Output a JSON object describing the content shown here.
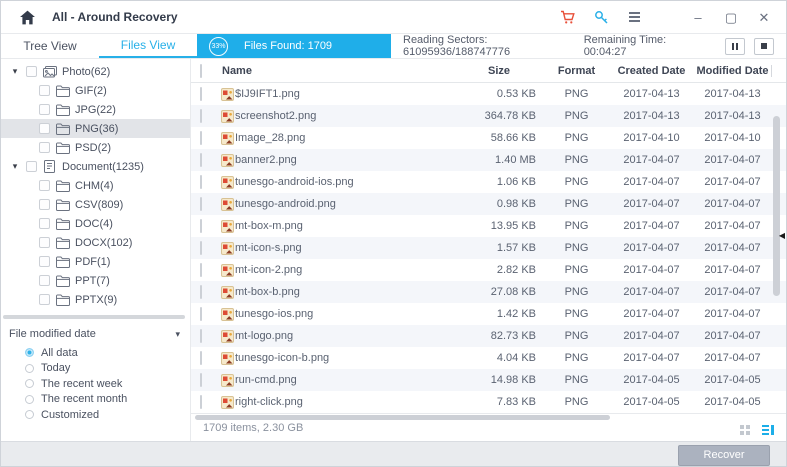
{
  "window": {
    "title": "All - Around Recovery"
  },
  "titlebar": {
    "icons": [
      "home-icon",
      "cart-icon",
      "key-icon",
      "menu-icon",
      "minimize-icon",
      "maximize-icon",
      "close-icon"
    ],
    "minimize_glyph": "–",
    "maximize_glyph": "▢",
    "close_glyph": "✕"
  },
  "tabs": [
    {
      "label": "Tree View",
      "active": false
    },
    {
      "label": "Files View",
      "active": true
    }
  ],
  "progress": {
    "percent": "33%",
    "files_found": "Files Found: 1709",
    "reading_sectors": "Reading Sectors: 61095936/188747776",
    "remaining_time": "Remaining Time: 00:04:27"
  },
  "sidebar": {
    "tree": [
      {
        "label": "Photo(62)",
        "icon": "photo",
        "level": 0,
        "expanded": true,
        "selected": false
      },
      {
        "label": "GIF(2)",
        "icon": "folder",
        "level": 1,
        "selected": false
      },
      {
        "label": "JPG(22)",
        "icon": "folder",
        "level": 1,
        "selected": false
      },
      {
        "label": "PNG(36)",
        "icon": "folder",
        "level": 1,
        "selected": true
      },
      {
        "label": "PSD(2)",
        "icon": "folder",
        "level": 1,
        "selected": false
      },
      {
        "label": "Document(1235)",
        "icon": "document",
        "level": 0,
        "expanded": true,
        "selected": false
      },
      {
        "label": "CHM(4)",
        "icon": "folder",
        "level": 1,
        "selected": false
      },
      {
        "label": "CSV(809)",
        "icon": "folder",
        "level": 1,
        "selected": false
      },
      {
        "label": "DOC(4)",
        "icon": "folder",
        "level": 1,
        "selected": false
      },
      {
        "label": "DOCX(102)",
        "icon": "folder",
        "level": 1,
        "selected": false
      },
      {
        "label": "PDF(1)",
        "icon": "folder",
        "level": 1,
        "selected": false
      },
      {
        "label": "PPT(7)",
        "icon": "folder",
        "level": 1,
        "selected": false
      },
      {
        "label": "PPTX(9)",
        "icon": "folder",
        "level": 1,
        "selected": false
      }
    ],
    "filter": {
      "title": "File modified date",
      "options": [
        {
          "label": "All data",
          "selected": true
        },
        {
          "label": "Today",
          "selected": false
        },
        {
          "label": "The recent week",
          "selected": false
        },
        {
          "label": "The recent month",
          "selected": false
        },
        {
          "label": "Customized",
          "selected": false
        }
      ]
    }
  },
  "table": {
    "columns": [
      "Name",
      "Size",
      "Format",
      "Created Date",
      "Modified Date"
    ],
    "rows": [
      {
        "name": "$IJ9IFT1.png",
        "size": "0.53 KB",
        "format": "PNG",
        "created": "2017-04-13",
        "modified": "2017-04-13"
      },
      {
        "name": "screenshot2.png",
        "size": "364.78 KB",
        "format": "PNG",
        "created": "2017-04-13",
        "modified": "2017-04-13"
      },
      {
        "name": "Image_28.png",
        "size": "58.66 KB",
        "format": "PNG",
        "created": "2017-04-10",
        "modified": "2017-04-10"
      },
      {
        "name": "banner2.png",
        "size": "1.40 MB",
        "format": "PNG",
        "created": "2017-04-07",
        "modified": "2017-04-07"
      },
      {
        "name": "tunesgo-android-ios.png",
        "size": "1.06 KB",
        "format": "PNG",
        "created": "2017-04-07",
        "modified": "2017-04-07"
      },
      {
        "name": "tunesgo-android.png",
        "size": "0.98 KB",
        "format": "PNG",
        "created": "2017-04-07",
        "modified": "2017-04-07"
      },
      {
        "name": "mt-box-m.png",
        "size": "13.95 KB",
        "format": "PNG",
        "created": "2017-04-07",
        "modified": "2017-04-07"
      },
      {
        "name": "mt-icon-s.png",
        "size": "1.57 KB",
        "format": "PNG",
        "created": "2017-04-07",
        "modified": "2017-04-07"
      },
      {
        "name": "mt-icon-2.png",
        "size": "2.82 KB",
        "format": "PNG",
        "created": "2017-04-07",
        "modified": "2017-04-07"
      },
      {
        "name": "mt-box-b.png",
        "size": "27.08 KB",
        "format": "PNG",
        "created": "2017-04-07",
        "modified": "2017-04-07"
      },
      {
        "name": "tunesgo-ios.png",
        "size": "1.42 KB",
        "format": "PNG",
        "created": "2017-04-07",
        "modified": "2017-04-07"
      },
      {
        "name": "mt-logo.png",
        "size": "82.73 KB",
        "format": "PNG",
        "created": "2017-04-07",
        "modified": "2017-04-07"
      },
      {
        "name": "tunesgo-icon-b.png",
        "size": "4.04 KB",
        "format": "PNG",
        "created": "2017-04-07",
        "modified": "2017-04-07"
      },
      {
        "name": "run-cmd.png",
        "size": "14.98 KB",
        "format": "PNG",
        "created": "2017-04-05",
        "modified": "2017-04-05"
      },
      {
        "name": "right-click.png",
        "size": "7.83 KB",
        "format": "PNG",
        "created": "2017-04-05",
        "modified": "2017-04-05"
      }
    ]
  },
  "footer": {
    "summary": "1709 items, 2.30 GB",
    "recover_label": "Recover"
  },
  "colors": {
    "accent_blue": "#1FAEE9",
    "cart_red": "#E8503A",
    "title_navy": "#333B4A",
    "row_alt": "#F4F6FA",
    "tree_selected": "#E2E4E8",
    "recover_gray": "#ABB2BF"
  }
}
